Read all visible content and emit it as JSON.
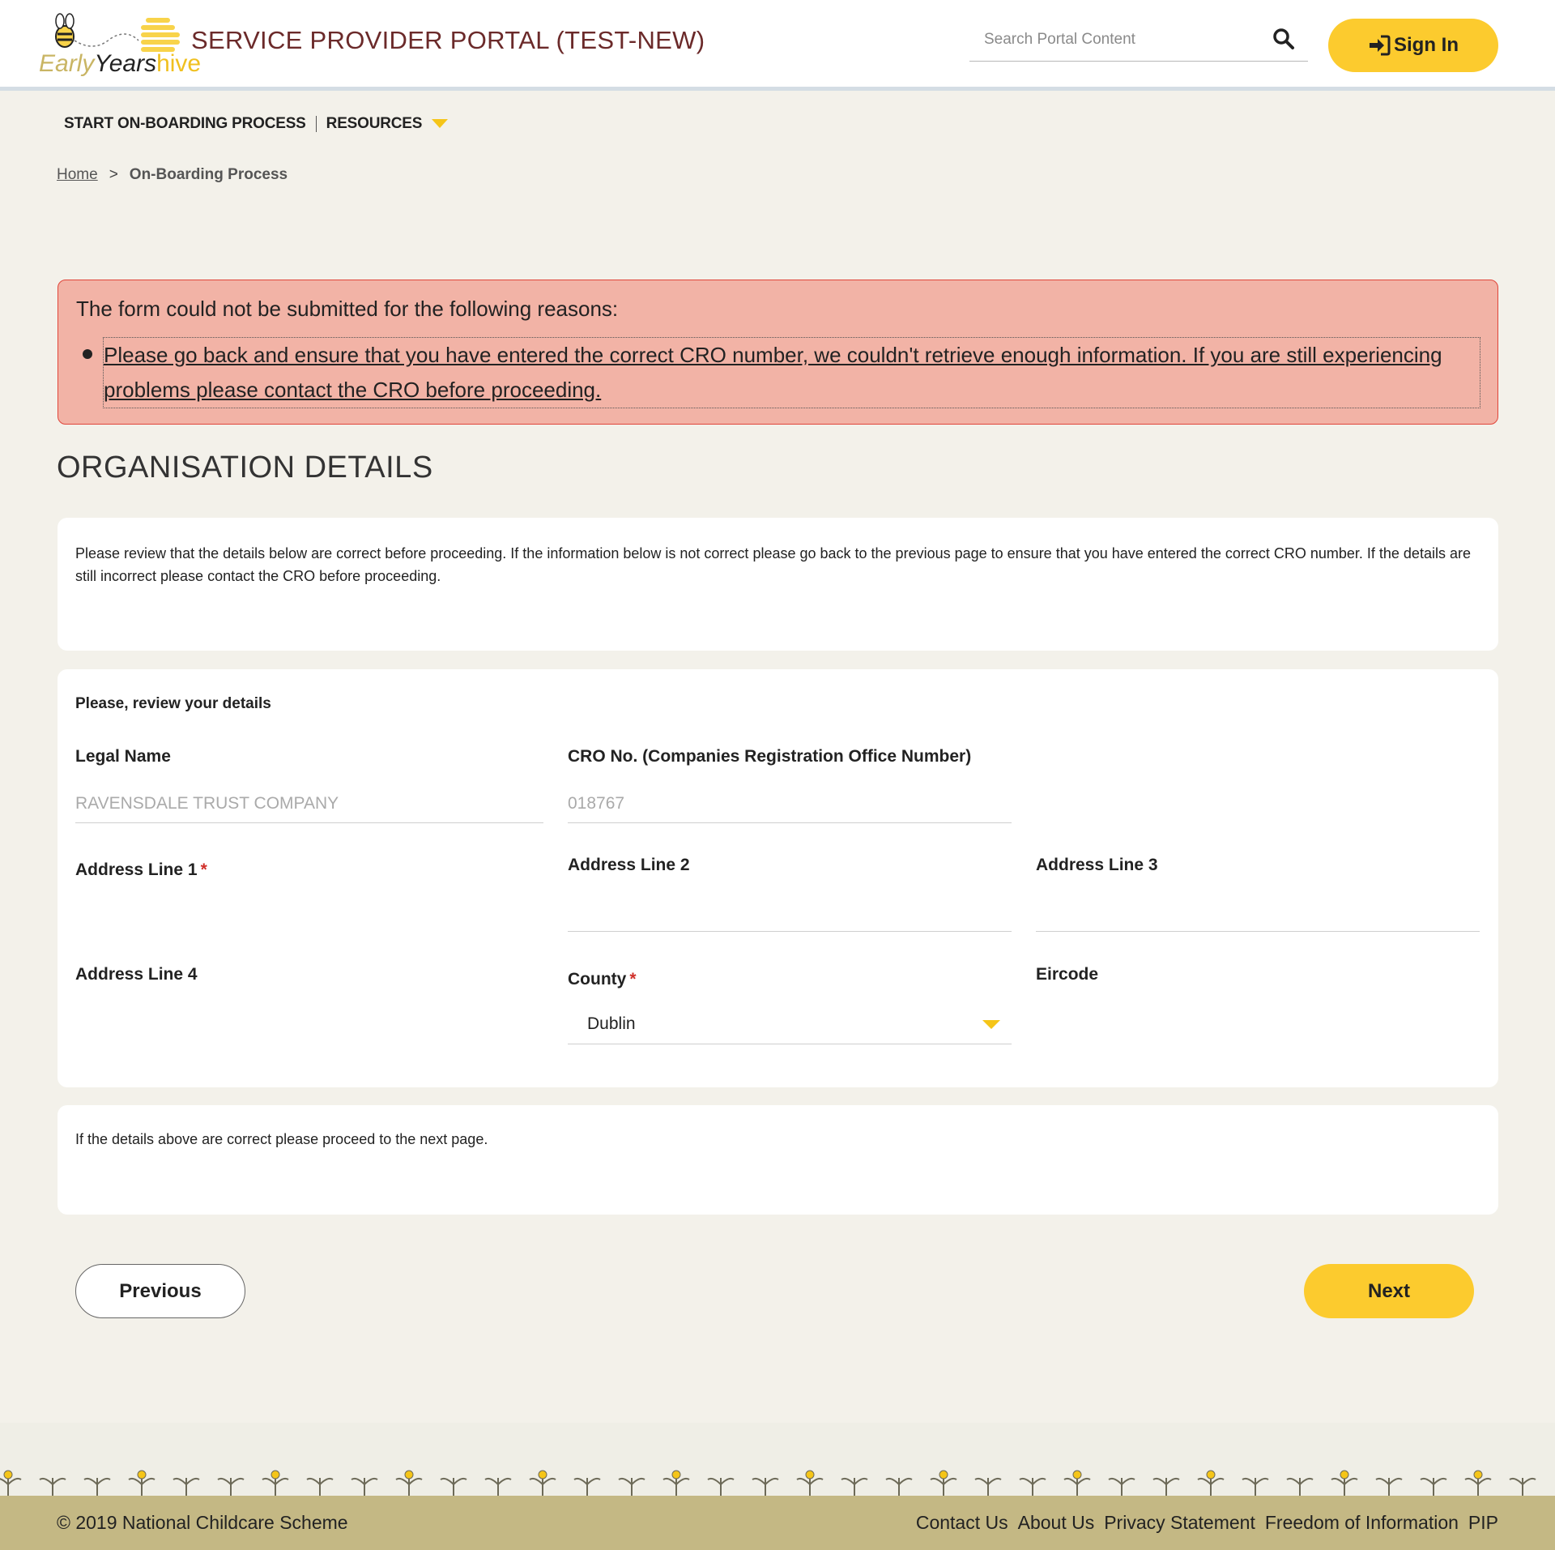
{
  "header": {
    "logo_text_early": "Early",
    "logo_text_years": "Years",
    "logo_text_hive": "hive",
    "portal_title": "SERVICE PROVIDER PORTAL (TEST-NEW)",
    "search_placeholder": "Search Portal Content",
    "sign_in_label": "Sign In"
  },
  "nav": {
    "items": [
      {
        "label": "START ON-BOARDING PROCESS"
      },
      {
        "label": "RESOURCES"
      }
    ]
  },
  "breadcrumb": {
    "home": "Home",
    "separator": ">",
    "current": "On-Boarding Process"
  },
  "error": {
    "title": "The form could not be submitted for the following reasons:",
    "message": "Please go back and ensure that you have entered the correct CRO number, we couldn't retrieve enough information. If you are still experiencing problems please contact the CRO before proceeding."
  },
  "section_title": "ORGANISATION DETAILS",
  "intro_text": "Please review that the details below are correct before proceeding. If the information below is not correct please go back to the previous page to ensure that you have entered the correct CRO number. If the details are still incorrect please contact the CRO before proceeding.",
  "form": {
    "review_label": "Please, review your details",
    "legal_name_label": "Legal Name",
    "legal_name_value": "RAVENSDALE TRUST COMPANY",
    "cro_label": "CRO No. (Companies Registration Office Number)",
    "cro_value": "018767",
    "address1_label": "Address Line 1",
    "address2_label": "Address Line 2",
    "address3_label": "Address Line 3",
    "address4_label": "Address Line 4",
    "county_label": "County",
    "county_value": "Dublin",
    "eircode_label": "Eircode",
    "required_mark": "*"
  },
  "proceed_text": "If the details above are correct please proceed to the next page.",
  "buttons": {
    "previous": "Previous",
    "next": "Next"
  },
  "footer": {
    "copyright": "© 2019 National Childcare Scheme",
    "links": [
      "Contact Us",
      "About Us",
      "Privacy Statement",
      "Freedom of Information",
      "PIP"
    ]
  },
  "colors": {
    "accent": "#fccb2e",
    "title": "#6b2a2a",
    "error_bg": "#f2b3a6",
    "error_border": "#e0453a",
    "footer": "#c4b884"
  }
}
